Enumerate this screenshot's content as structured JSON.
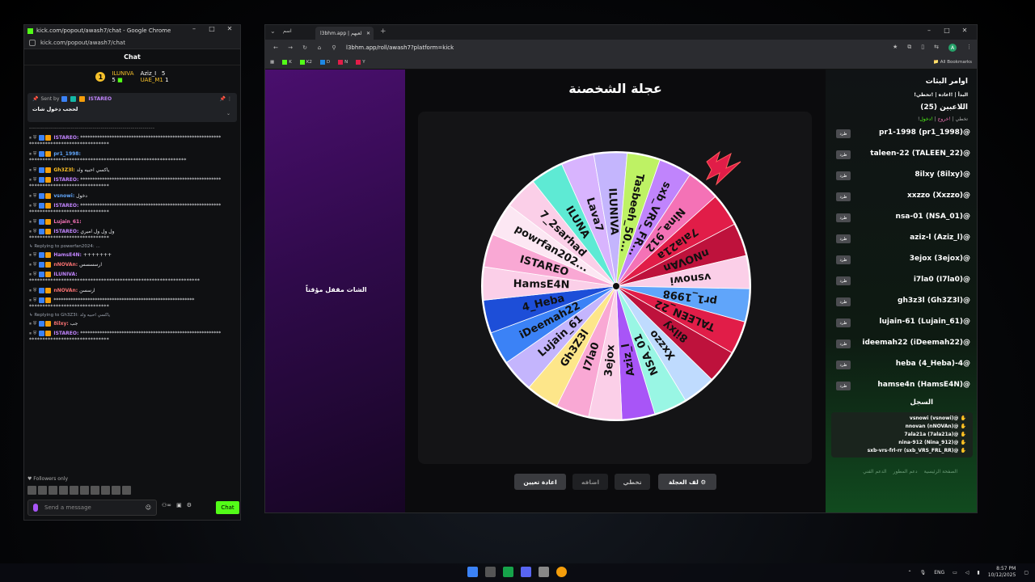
{
  "chat_window": {
    "title": "kick.com/popout/awash7/chat - Google Chrome",
    "url": "kick.com/popout/awash7/chat",
    "header": "Chat",
    "leaderboard": [
      {
        "rank": "1",
        "name": "ILUNIVA",
        "count": "5"
      },
      {
        "name": "Aziz_I",
        "count": "5"
      },
      {
        "name": "UAE_M1",
        "count": "1"
      }
    ],
    "pinned": {
      "label": "Sent by",
      "user": "ISTAREO",
      "text": "لحجب دخول شات"
    },
    "messages": [
      {
        "user": "ISTAREO:",
        "text": "**********************************************************",
        "cont": "******************************",
        "cls": "u-purple"
      },
      {
        "user": "pr1_1998:",
        "text": "",
        "cont": "***********************************************************",
        "cls": "u-blue"
      },
      {
        "user": "Gh3Z3l:",
        "text": "ياكسي احبيه ولد",
        "cont": "",
        "cls": "u-yellow"
      },
      {
        "user": "ISTAREO:",
        "text": "**********************************************************",
        "cont": "******************************",
        "cls": "u-purple"
      },
      {
        "user": "vsnowi:",
        "text": "دخول",
        "cont": "",
        "cls": "u-blue"
      },
      {
        "user": "ISTAREO:",
        "text": "**********************************************************",
        "cont": "******************************",
        "cls": "u-purple"
      },
      {
        "user": "Lujain_61:",
        "text": "",
        "cont": "",
        "cls": "u-pink"
      },
      {
        "user": "ISTAREO:",
        "text": "ول ول ول اميري",
        "cont": "******************************",
        "cls": "u-purple"
      }
    ],
    "reply1": "Replying to powerfan2024: ...",
    "messages2": [
      {
        "user": "HamsE4N:",
        "text": "+++++++",
        "cont": "",
        "cls": "u-purple"
      },
      {
        "user": "nNOVAn:",
        "text": "ارسسسس",
        "cont": "",
        "cls": "u-red"
      },
      {
        "user": "ILUNIVA:",
        "text": "",
        "cont": "****************************************************************",
        "cls": "u-purple"
      },
      {
        "user": "nNOVAn:",
        "text": "ارسسن",
        "cont": "",
        "cls": "u-red"
      },
      {
        "user": "",
        "text": "**********************************************************",
        "cont": "******************************",
        "cls": "u-purple"
      }
    ],
    "reply2": "Replying to Gh3Z3l: ياكسي احبيه ولد",
    "messages3": [
      {
        "user": "8ilxy:",
        "text": "جب",
        "cont": "",
        "cls": "u-red"
      },
      {
        "user": "ISTAREO:",
        "text": "**********************************************************",
        "cont": "******************************",
        "cls": "u-purple"
      }
    ],
    "followers_only": "Followers only",
    "send_placeholder": "Send a message",
    "chat_button": "Chat"
  },
  "browser": {
    "tab_title": "l3bhm.app | لعبهم",
    "tab_left": "اسم",
    "url": "l3bhm.app/roll/awash7?platform=kick",
    "bookmarks": [
      {
        "label": "K",
        "color": "green"
      },
      {
        "label": "K2",
        "color": "green"
      },
      {
        "label": "D",
        "color": "tw"
      },
      {
        "label": "N",
        "color": "red"
      },
      {
        "label": "Y",
        "color": "red"
      }
    ],
    "all_bookmarks": "All Bookmarks"
  },
  "page": {
    "chat_closed": "الشات مقفل مؤقتاً",
    "wheel_title": "عجلة الشخصنة",
    "buttons": {
      "reset": "اعادة تعيين",
      "add": "اضافه",
      "skip": "تخطي",
      "spin": "لف العجلة"
    },
    "commands_title": "اوامر البثات",
    "commands": "!البدأ | !اعاده | !تخطي",
    "players_count": "اللاعبين (25)",
    "links": {
      "join": "!دخول",
      "leave": "!خروج",
      "skip": "!تخطي"
    },
    "kick_label": "طرد",
    "players": [
      "pr1-1998 (pr1_1998)@",
      "taleen-22 (TALEEN_22)@",
      "8ilxy (8ilxy)@",
      "xxzzo (Xxzzo)@",
      "nsa-01 (NSA_01)@",
      "aziz-l (Aziz_l)@",
      "3ejox (3ejox)@",
      "i7la0 (I7la0)@",
      "gh3z3l (Gh3Z3l)@",
      "lujain-61 (Lujain_61)@",
      "ideemah22 (iDeemah22)@",
      "heba (4_Heba)-4@",
      "hamse4n (HamsE4N)@"
    ],
    "log_title": "السجل",
    "log": [
      "vsnowi (vsnowi)@",
      "nnovan (nNOVAn)@",
      "7ala21a (7ala21a)@",
      "nina-912 (Nina_912)@",
      "sxb-vrs-frl-rr (sxb_VRS_FRL_RR)@"
    ],
    "footer": [
      "الصفحة الرئيسية",
      "دعم المطور",
      "الدعم الفني"
    ]
  },
  "chart_data": {
    "type": "pie",
    "categories": [
      "Lava7",
      "ILUNIVA",
      "Tasbeeh_50...",
      "sxb_VRS_FR...",
      "Nina_912",
      "7ala21a",
      "nNOVAn",
      "vsnowi",
      "pr1_1998",
      "TALEEN_22",
      "8ilxy",
      "Xxzzo",
      "NSA_01",
      "Aziz_l",
      "3ejox",
      "I7la0",
      "Gh3Z3l",
      "Lujain_61",
      "iDeemah22",
      "4_Heba",
      "HamsE4N",
      "ISTAREO",
      "powrfan202...",
      "7_2sarhad",
      "ILUNA"
    ],
    "values": [
      1,
      1,
      1,
      1,
      1,
      1,
      1,
      1,
      1,
      1,
      1,
      1,
      1,
      1,
      1,
      1,
      1,
      1,
      1,
      1,
      1,
      1,
      1,
      1,
      1
    ],
    "colors": [
      "#d8b4fe",
      "#c4b5fd",
      "#bef264",
      "#c084fc",
      "#f472b6",
      "#e11d48",
      "#be123c",
      "#fbcfe8",
      "#60a5fa",
      "#e11d48",
      "#be123c",
      "#bfdbfe",
      "#99f6e4",
      "#a855f7",
      "#fbcfe8",
      "#f9a8d4",
      "#fde68a",
      "#c4b5fd",
      "#3b82f6",
      "#1d4ed8",
      "#fbcfe8",
      "#f9a8d4",
      "#fce7f3",
      "#fbcfe8",
      "#5eead4"
    ]
  },
  "taskbar": {
    "lang": "ENG",
    "time": "8:57 PM",
    "date": "10/12/2025"
  }
}
